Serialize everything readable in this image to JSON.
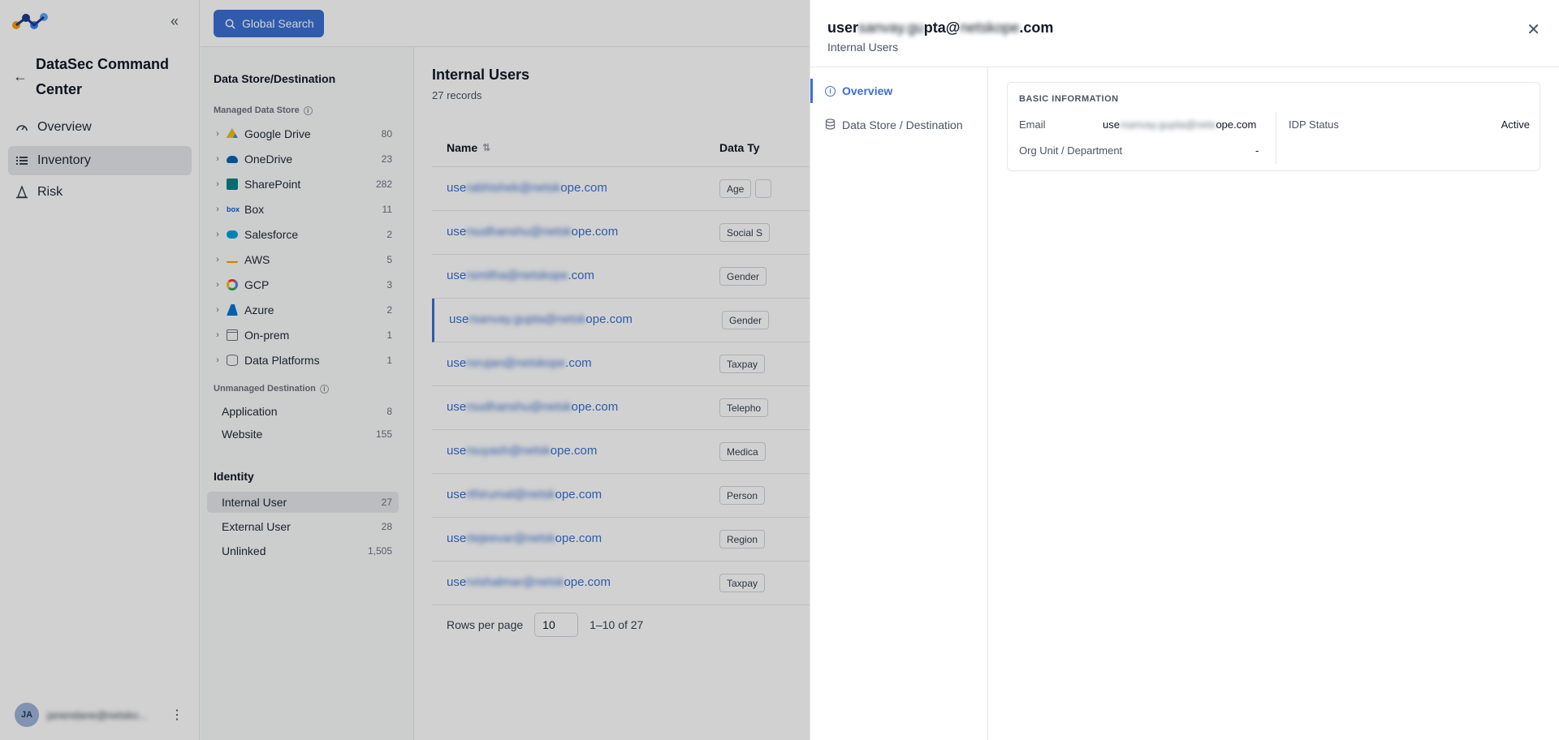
{
  "nav": {
    "app_title": "DataSec Command Center",
    "items": [
      {
        "label": "Overview",
        "icon": "gauge-icon"
      },
      {
        "label": "Inventory",
        "icon": "list-icon"
      },
      {
        "label": "Risk",
        "icon": "cone-icon"
      }
    ],
    "user_initials": "JA",
    "user_email": "janendane@netsko..."
  },
  "topbar": {
    "search_label": "Global Search"
  },
  "tree": {
    "section1_title": "Data Store/Destination",
    "managed_title": "Managed Data Store",
    "managed": [
      {
        "label": "Google Drive",
        "count": "80"
      },
      {
        "label": "OneDrive",
        "count": "23"
      },
      {
        "label": "SharePoint",
        "count": "282"
      },
      {
        "label": "Box",
        "count": "11"
      },
      {
        "label": "Salesforce",
        "count": "2"
      },
      {
        "label": "AWS",
        "count": "5"
      },
      {
        "label": "GCP",
        "count": "3"
      },
      {
        "label": "Azure",
        "count": "2"
      },
      {
        "label": "On-prem",
        "count": "1"
      },
      {
        "label": "Data Platforms",
        "count": "1"
      }
    ],
    "unmanaged_title": "Unmanaged Destination",
    "unmanaged": [
      {
        "label": "Application",
        "count": "8"
      },
      {
        "label": "Website",
        "count": "155"
      }
    ],
    "identity_title": "Identity",
    "identity": [
      {
        "label": "Internal User",
        "count": "27"
      },
      {
        "label": "External User",
        "count": "28"
      },
      {
        "label": "Unlinked",
        "count": "1,505"
      }
    ]
  },
  "list": {
    "title": "Internal Users",
    "subtitle": "27 records",
    "col_name": "Name",
    "col_type": "Data Ty",
    "rows": [
      {
        "pre": "use",
        "mid": "rabhishek@netsk",
        "post": "ope.com",
        "tag": "Age"
      },
      {
        "pre": "use",
        "mid": "rsudhanshu@netsk",
        "post": "ope.com",
        "tag": "Social S"
      },
      {
        "pre": "use",
        "mid": "rsmitha@netskope",
        "post": ".com",
        "tag": "Gender"
      },
      {
        "pre": "use",
        "mid": "rsanvay.gupta@netsk",
        "post": "ope.com",
        "tag": "Gender"
      },
      {
        "pre": "use",
        "mid": "rsrujan@netskope",
        "post": ".com",
        "tag": "Taxpay"
      },
      {
        "pre": "use",
        "mid": "rsudhanshu@netsk",
        "post": "ope.com",
        "tag": "Telepho"
      },
      {
        "pre": "use",
        "mid": "rsuyash@netsk",
        "post": "ope.com",
        "tag": "Medica"
      },
      {
        "pre": "use",
        "mid": "rthirumal@netsk",
        "post": "ope.com",
        "tag": "Person"
      },
      {
        "pre": "use",
        "mid": "rtejeevar@netsk",
        "post": "ope.com",
        "tag": "Region"
      },
      {
        "pre": "use",
        "mid": "rvishalmar@netsk",
        "post": "ope.com",
        "tag": "Taxpay"
      }
    ],
    "rows_per_page_label": "Rows per page",
    "rows_per_page": "10",
    "range": "1–10 of 27"
  },
  "drawer": {
    "title_pre": "user",
    "title_mid": "sanvay.gu",
    "title_post": "pta@",
    "title_mid2": "netskope",
    "title_end": ".com",
    "subtitle": "Internal Users",
    "tabs": [
      {
        "label": "Overview"
      },
      {
        "label": "Data Store / Destination"
      }
    ],
    "card_title": "BASIC INFORMATION",
    "email_label": "Email",
    "email_pre": "use",
    "email_mid": "rsanvay.gupta@nets",
    "email_post": "ope.com",
    "org_label": "Org Unit / Department",
    "org_value": "-",
    "idp_label": "IDP Status",
    "idp_value": "Active"
  }
}
